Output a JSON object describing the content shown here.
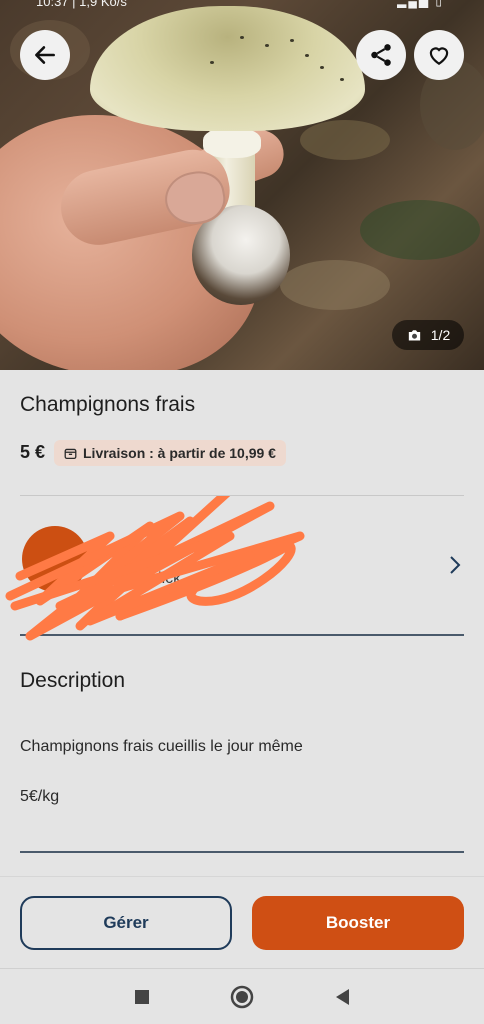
{
  "status_bar": {
    "time_fragment": "10:37 | 1,9 Ko/s",
    "right_fragment": "▂▄▆ ▯"
  },
  "photo": {
    "counter": "1/2"
  },
  "listing": {
    "title": "Champignons frais",
    "price": "5 €",
    "delivery": "Livraison : à partir de 10,99 €"
  },
  "seller": {
    "name": "mariaclick"
  },
  "description": {
    "heading": "Description",
    "line1": "Champignons frais cueillis le jour même",
    "line2": "5€/kg"
  },
  "actions": {
    "manage": "Gérer",
    "boost": "Booster"
  },
  "colors": {
    "accent": "#cf4f14",
    "primary_dark": "#1f3b5a",
    "scribble": "#ff7a45"
  },
  "icons": [
    "back-arrow-icon",
    "share-icon",
    "heart-icon",
    "camera-icon",
    "package-icon",
    "chevron-right-icon",
    "square-icon",
    "circle-icon",
    "triangle-back-icon"
  ]
}
